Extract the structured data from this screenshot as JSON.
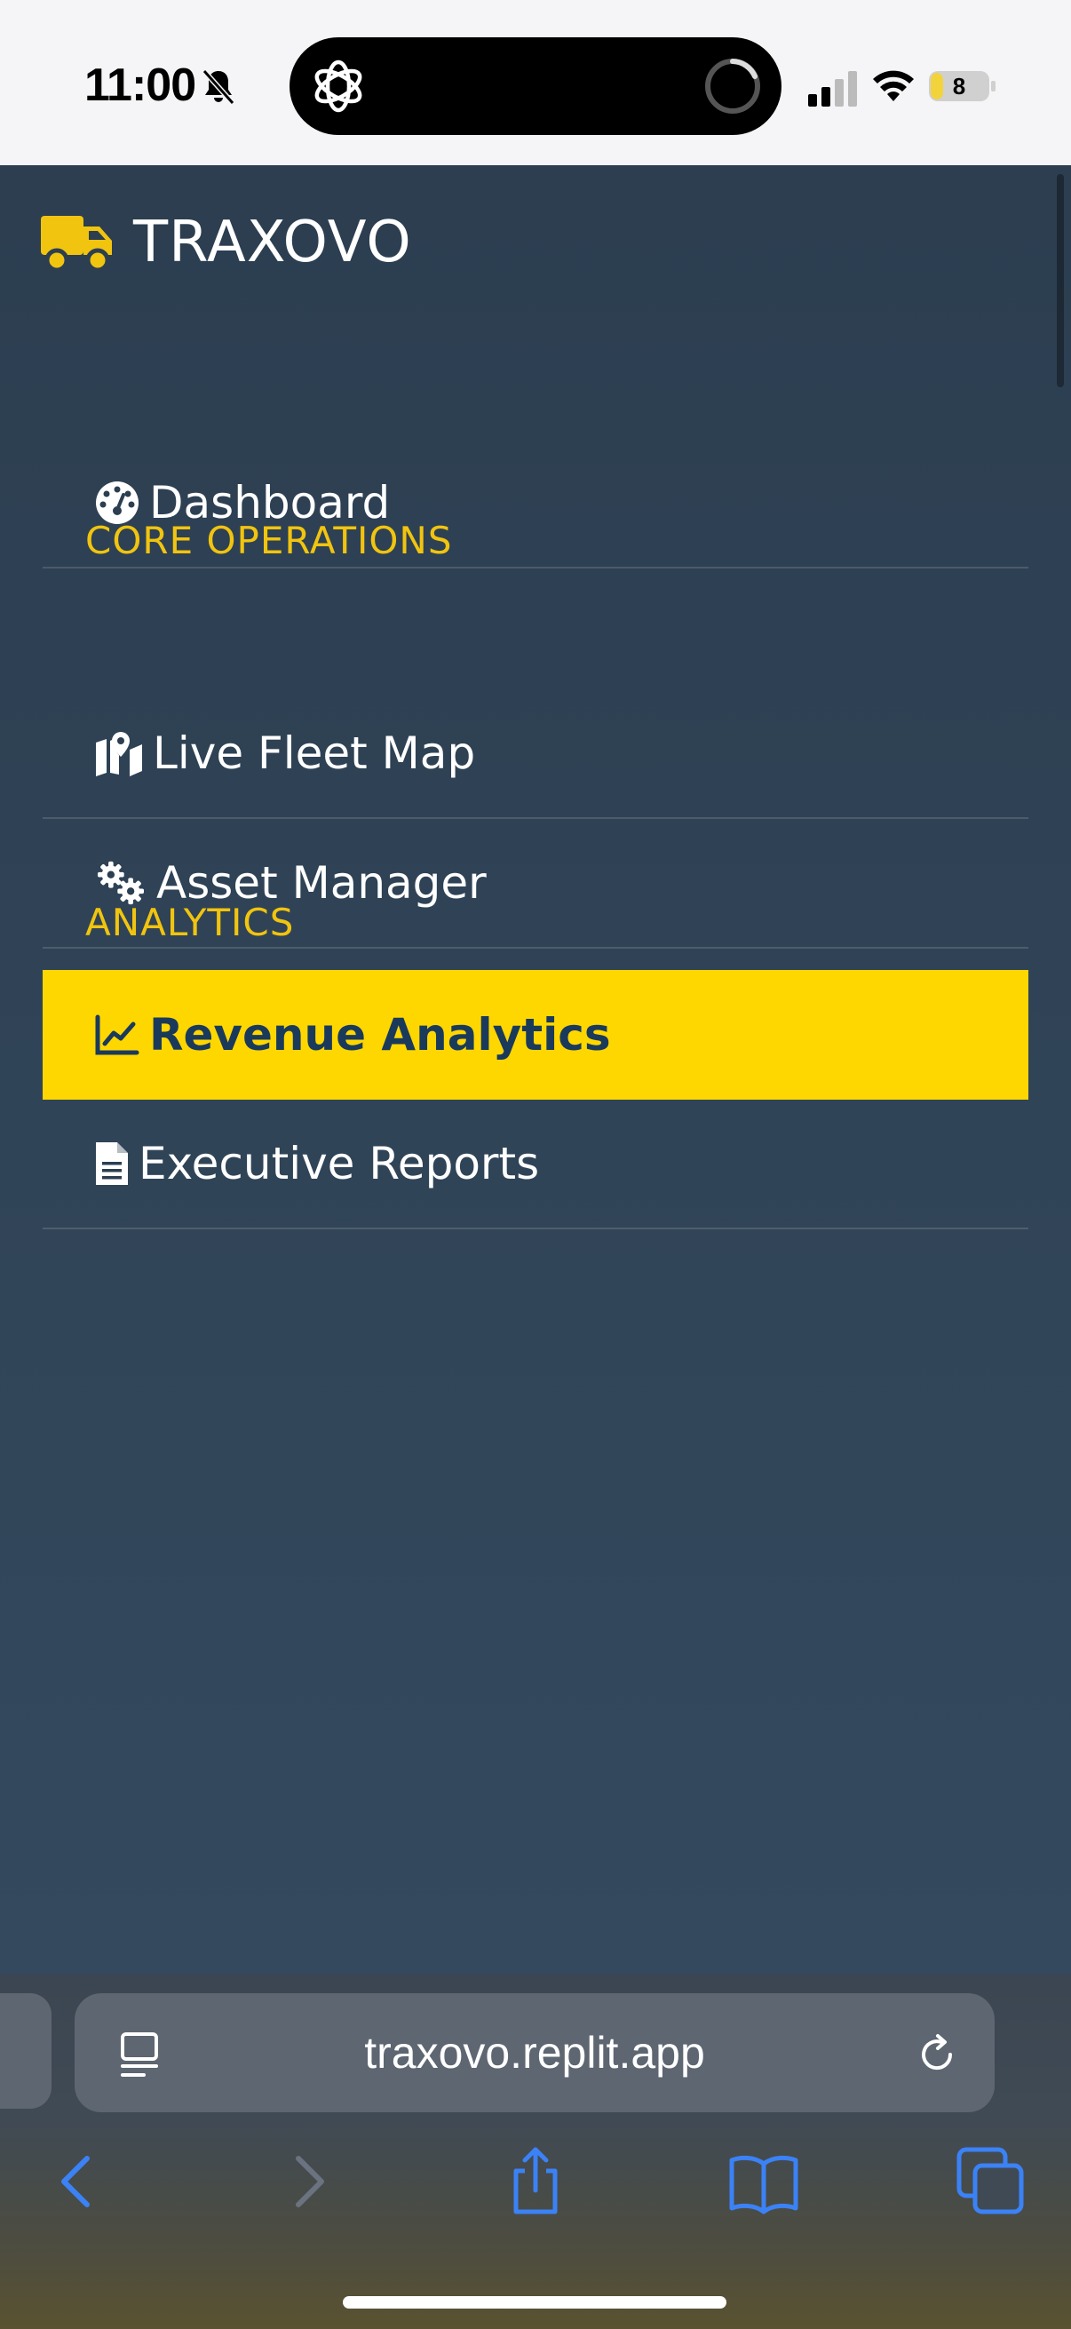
{
  "status_bar": {
    "time": "11:00",
    "battery_level": "8",
    "icons": [
      "bell-slash-icon",
      "chatgpt-logo-icon",
      "loading-spinner-icon",
      "cellular-signal-icon",
      "wifi-icon",
      "battery-icon"
    ]
  },
  "sidebar": {
    "brand": {
      "icon": "truck-icon",
      "name": "TRAXOVO"
    },
    "items": [
      {
        "icon": "gauge-icon",
        "label": "Dashboard"
      },
      {
        "icon": "map-icon",
        "label": "Live Fleet Map",
        "section": "CORE OPERATIONS"
      },
      {
        "icon": "cogs-icon",
        "label": "Asset Manager"
      },
      {
        "icon": "chart-line-icon",
        "label": "Revenue Analytics",
        "section": "ANALYTICS",
        "active": true
      },
      {
        "icon": "file-text-icon",
        "label": "Executive Reports"
      }
    ],
    "sections": {
      "core": "CORE OPERATIONS",
      "analytics": "ANALYTICS"
    }
  },
  "browser": {
    "url": "traxovo.replit.app",
    "toolbar": [
      "back-icon",
      "forward-icon",
      "share-icon",
      "bookmarks-icon",
      "tabs-icon"
    ]
  },
  "colors": {
    "sidebar_bg": "#2c3e50",
    "accent": "#ffd700",
    "section_label": "#f1c40f",
    "active_text": "#1a3a5c"
  }
}
